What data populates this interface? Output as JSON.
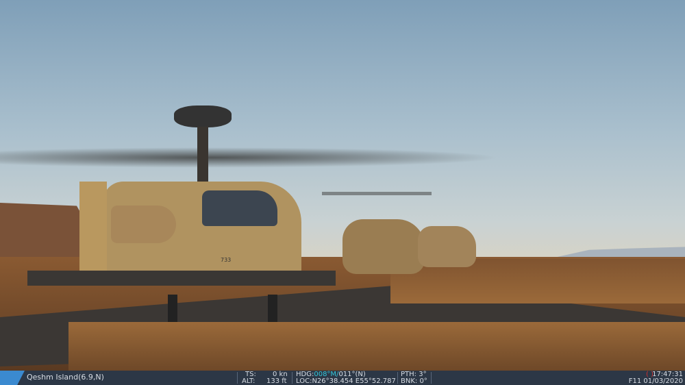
{
  "hud": {
    "location": "Qeshm Island(6.9,N)",
    "ts_label": "TS:",
    "ts_value": "0 kn",
    "alt_label": "ALT:",
    "alt_value": "133 ft",
    "hdg_label": "HDG:",
    "hdg_magnetic": "008°M/",
    "hdg_true": "011°(N)",
    "loc": "LOC:N26°38.454 E55°52.787",
    "pth": "PTH: 3°",
    "bnk": "BNK: 0°",
    "indicator": "( )",
    "time": "17:47:31",
    "date": "F11 01/03/2020"
  },
  "scene": {
    "aircraft_marking": "733"
  },
  "colors": {
    "hud_bg": "#2c3746",
    "accent": "#35c6d8",
    "indicator": "#d03030"
  }
}
